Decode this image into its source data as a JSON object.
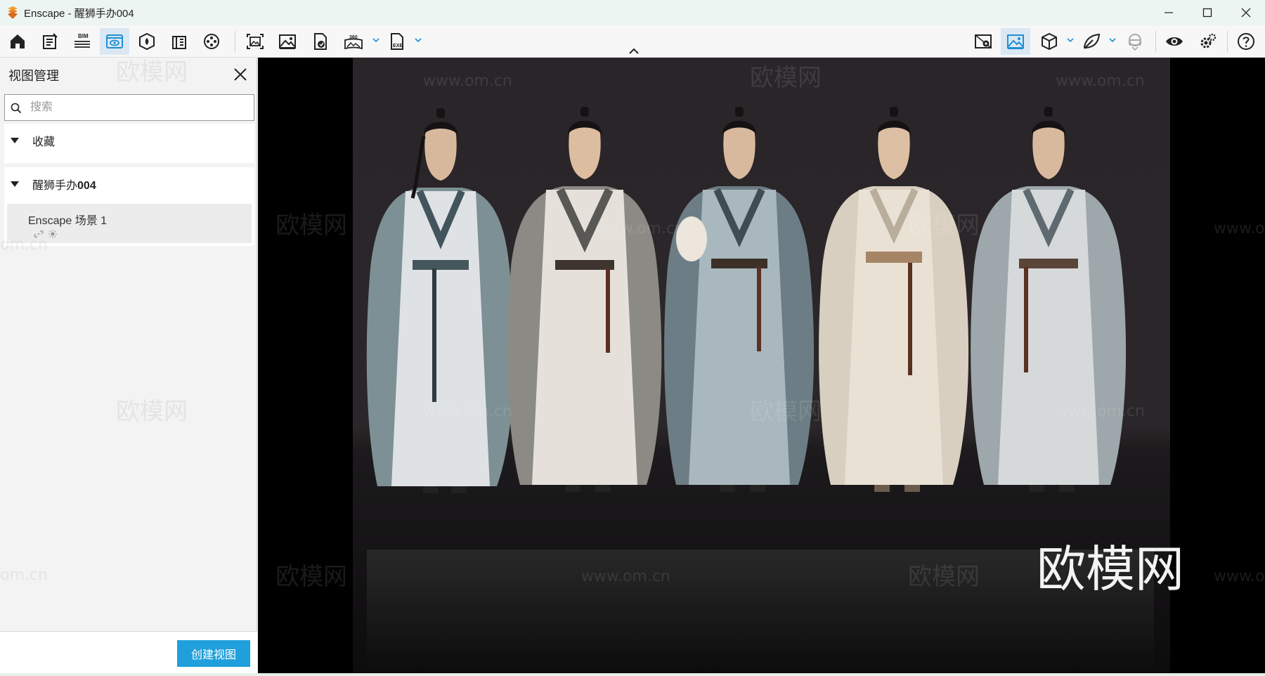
{
  "window": {
    "app_name": "Enscape - 醒狮手办004"
  },
  "toolbar": {
    "left_icons": [
      "home-icon",
      "notes-icon",
      "bim-icon",
      "view-management-icon",
      "asset-library-icon",
      "building-icon",
      "video-reel-icon",
      "screenshot-icon",
      "image-icon",
      "render-file-icon",
      "panorama-360-icon",
      "exe-export-icon"
    ],
    "bim_label": "BIM",
    "pano_label": "360",
    "exe_label": "EXE",
    "right_icons": [
      "map-pin-icon",
      "visual-settings-icon",
      "cube-view-icon",
      "material-leaf-icon",
      "vr-headset-icon",
      "eye-icon",
      "settings-gears-icon",
      "help-icon"
    ],
    "accent": "#1e8fd6"
  },
  "panel": {
    "title": "视图管理",
    "search_placeholder": "搜索",
    "favorites_label": "收藏",
    "project_prefix": "醒狮手办",
    "project_suffix": "004",
    "scene_name": "Enscape 场景 1",
    "create_button": "创建视图",
    "button_color": "#1fa0dc"
  },
  "watermarks": {
    "brand": "欧模网",
    "url": "www.om.cn",
    "partial_url": "om.cn",
    "partial_url_right": "www.o"
  }
}
